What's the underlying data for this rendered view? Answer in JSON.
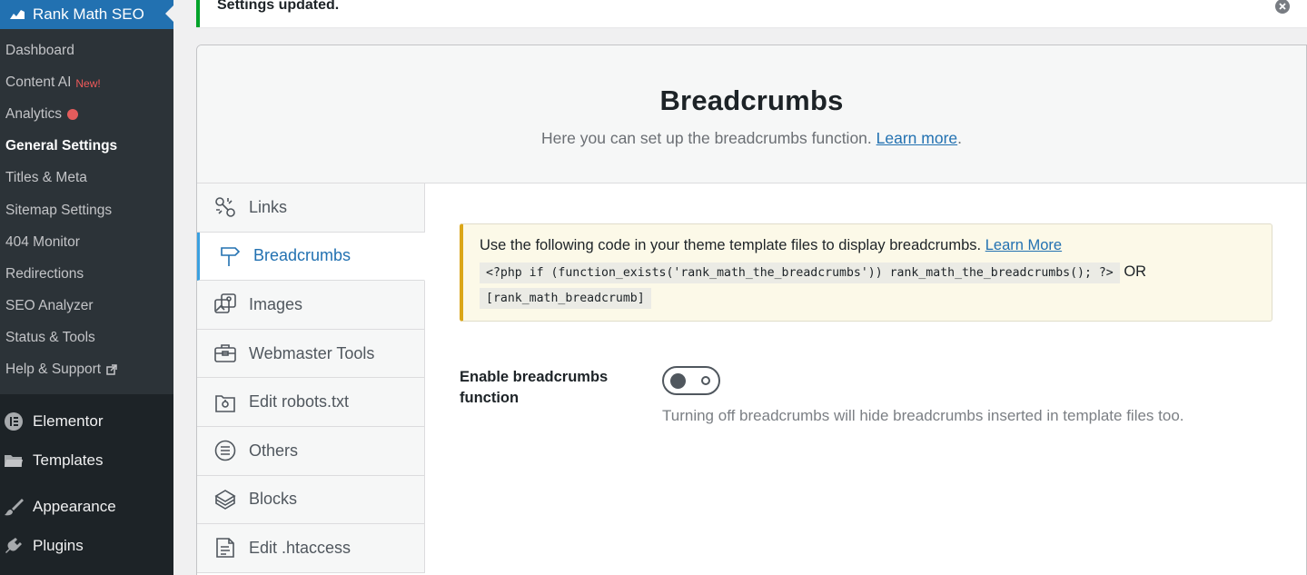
{
  "sidebar": {
    "plugin_title": "Rank Math SEO",
    "submenu": [
      {
        "label": "Dashboard"
      },
      {
        "label": "Content AI",
        "badge": "New!"
      },
      {
        "label": "Analytics"
      },
      {
        "label": "General Settings"
      },
      {
        "label": "Titles & Meta"
      },
      {
        "label": "Sitemap Settings"
      },
      {
        "label": "404 Monitor"
      },
      {
        "label": "Redirections"
      },
      {
        "label": "SEO Analyzer"
      },
      {
        "label": "Status & Tools"
      },
      {
        "label": "Help & Support"
      }
    ],
    "main_items": [
      {
        "label": "Elementor",
        "icon": "elementor-icon"
      },
      {
        "label": "Templates",
        "icon": "folder-icon"
      },
      {
        "label": "Appearance",
        "icon": "paintbrush-icon"
      },
      {
        "label": "Plugins",
        "icon": "plugin-icon"
      }
    ],
    "colors": {
      "background": "#1d2327",
      "active": "#2271b1",
      "submenu_bg": "#2c3338"
    }
  },
  "notice": {
    "text": "Settings updated."
  },
  "header": {
    "title": "Breadcrumbs",
    "description": "Here you can set up the breadcrumbs function.",
    "learn_more": "Learn more",
    "period": "."
  },
  "tabs": [
    {
      "label": "Links",
      "icon": "links-icon"
    },
    {
      "label": "Breadcrumbs",
      "icon": "signpost-icon",
      "active": true
    },
    {
      "label": "Images",
      "icon": "images-icon"
    },
    {
      "label": "Webmaster Tools",
      "icon": "toolbox-icon"
    },
    {
      "label": "Edit robots.txt",
      "icon": "file-icon"
    },
    {
      "label": "Others",
      "icon": "list-circle-icon"
    },
    {
      "label": "Blocks",
      "icon": "blocks-icon"
    },
    {
      "label": "Edit .htaccess",
      "icon": "document-icon"
    }
  ],
  "code_notice": {
    "text": "Use the following code in your theme template files to display breadcrumbs.",
    "learn_more": "Learn More",
    "php_code": "<?php if (function_exists('rank_math_the_breadcrumbs')) rank_math_the_breadcrumbs(); ?>",
    "or": "OR",
    "shortcode": "[rank_math_breadcrumb]"
  },
  "setting": {
    "label": "Enable breadcrumbs function",
    "enabled": false,
    "description": "Turning off breadcrumbs will hide breadcrumbs inserted in template files too."
  }
}
